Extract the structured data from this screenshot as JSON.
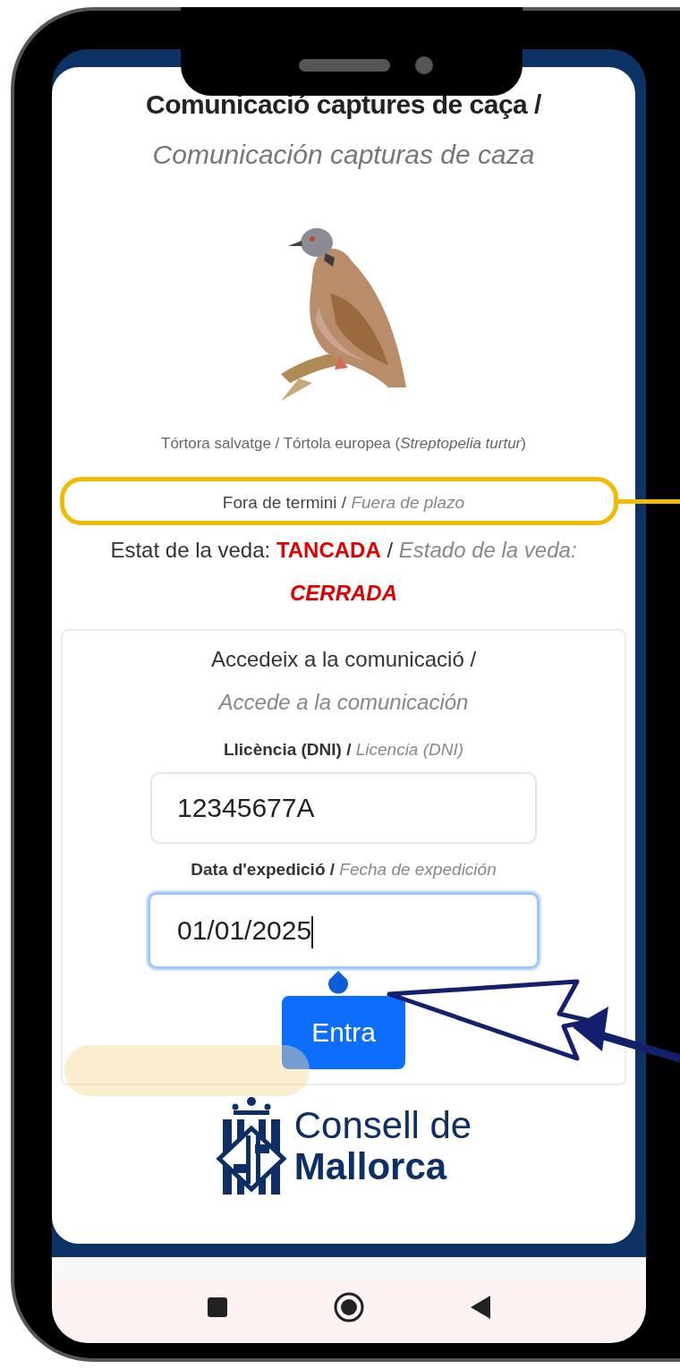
{
  "header": {
    "title": "Comunicació captures de caça /",
    "title_es": "Comunicación capturas de caza"
  },
  "species": {
    "caption": "Tórtora salvatge / Tórtola europea (*Streptopelia turtur*)"
  },
  "deadline": {
    "text": "Fora de termini /",
    "text_es": "Fuera de plazo"
  },
  "season": {
    "label": "Estat de la veda:",
    "status": "TANCADA",
    "separator": "/",
    "label_es": "Estado de la veda:",
    "status_es": "CERRADA"
  },
  "access_form": {
    "title": "Accedeix a la comunicació /",
    "title_es": "Accede a la comunicación",
    "fields": [
      {
        "label": "Llicència (DNI) /",
        "label_es": "Licencia (DNI)",
        "value": "12345677A",
        "focused": false
      },
      {
        "label": "Data d'expedició /",
        "label_es": "Fecha de expedición",
        "value": "01/01/2025",
        "focused": true
      }
    ],
    "button": "Entra"
  },
  "logo": {
    "line_1": "Consell de",
    "line_2": "Mallorca"
  },
  "annotations": [
    {
      "kind": "outline"
    },
    {
      "kind": "arrow"
    },
    {
      "kind": "highlight"
    }
  ]
}
